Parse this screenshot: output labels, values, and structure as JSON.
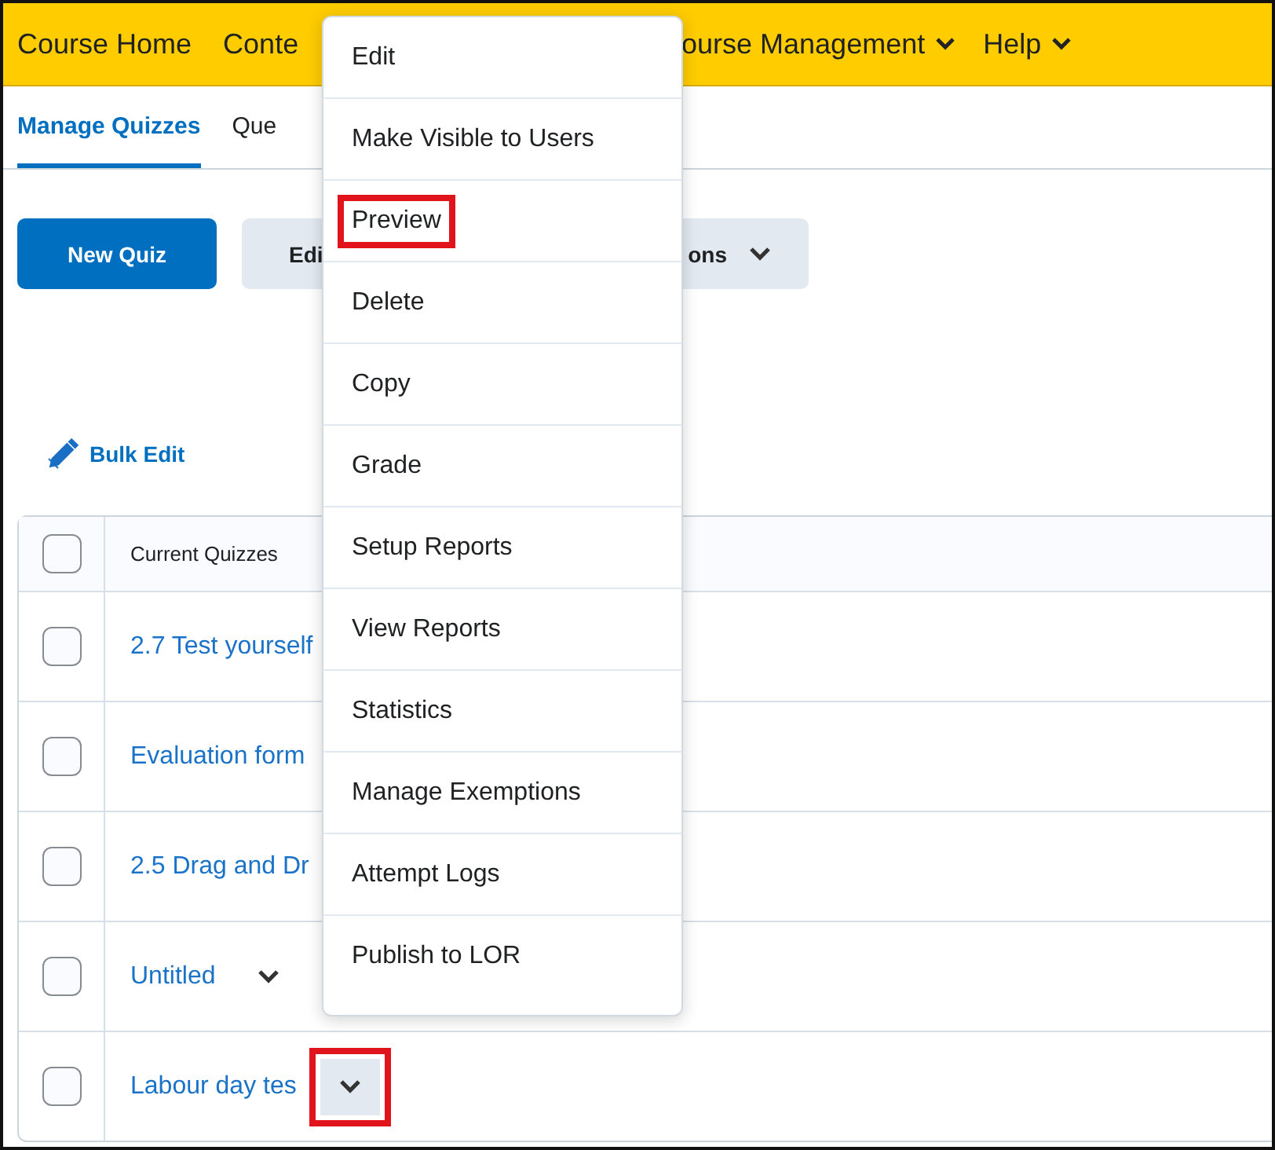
{
  "nav": [
    {
      "label": "Course Home",
      "has_menu": false
    },
    {
      "label": "Conte",
      "has_menu": false
    },
    {
      "label": "ourse Management",
      "has_menu": true
    },
    {
      "label": "Help",
      "has_menu": true
    }
  ],
  "tabs": [
    {
      "label": "Manage Quizzes",
      "selected": true
    },
    {
      "label": "Que",
      "selected": false
    }
  ],
  "toolbar": [
    {
      "kind": "primary",
      "label_parts": [
        "New Quiz"
      ],
      "has_menu": false
    },
    {
      "kind": "secondary",
      "label_parts": [
        "Edi",
        "ons"
      ],
      "has_menu": true
    }
  ],
  "bulk_edit": {
    "label": "Bulk Edit"
  },
  "table": {
    "columns": [
      "Current Quizzes"
    ],
    "header_checked": false,
    "rows": [
      {
        "title": "2.7 Test yourself",
        "checked": false
      },
      {
        "title": "Evaluation form",
        "checked": false
      },
      {
        "title": "2.5 Drag and Dr",
        "checked": false
      },
      {
        "title": "Untitled",
        "checked": false,
        "has_menu_button": true,
        "menu_button_hovered": false,
        "highlighted": false
      },
      {
        "title": "Labour day tes",
        "checked": false,
        "has_menu_button": true,
        "menu_button_hovered": true,
        "highlighted": true
      }
    ]
  },
  "context_menu": {
    "items": [
      {
        "label": "Edit",
        "highlighted": false
      },
      {
        "label": "Make Visible to Users",
        "highlighted": false
      },
      {
        "label": "Preview",
        "highlighted": true
      },
      {
        "label": "Delete",
        "highlighted": false
      },
      {
        "label": "Copy",
        "highlighted": false
      },
      {
        "label": "Grade",
        "highlighted": false
      },
      {
        "label": "Setup Reports",
        "highlighted": false
      },
      {
        "label": "View Reports",
        "highlighted": false
      },
      {
        "label": "Statistics",
        "highlighted": false
      },
      {
        "label": "Manage Exemptions",
        "highlighted": false
      },
      {
        "label": "Attempt Logs",
        "highlighted": false
      },
      {
        "label": "Publish to LOR",
        "highlighted": false
      }
    ]
  }
}
